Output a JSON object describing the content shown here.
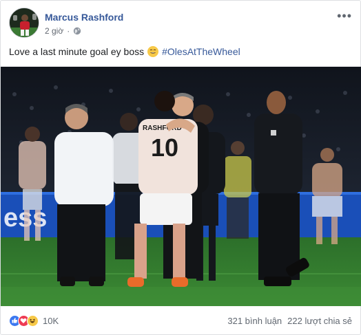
{
  "post": {
    "author": "Marcus Rashford",
    "time": "2 giờ",
    "caption_text": "Love a last minute goal ey boss",
    "hashtag": "#OlesAtTheWheel",
    "photo_jersey_name": "RASHFORD",
    "photo_jersey_number": "10",
    "photo_banner_text": "ess"
  },
  "footer": {
    "reaction_count": "10K",
    "comments": "321 bình luận",
    "shares": "222 lượt chia sẻ"
  },
  "colors": {
    "link": "#365899",
    "pitch": "#2f7a2c",
    "like": "#3b78f0",
    "love": "#ee3b53",
    "haha": "#f7c948"
  },
  "icons": [
    "globe-icon",
    "more-options-icon",
    "grin-emoji-icon",
    "like-reaction-icon",
    "love-reaction-icon",
    "haha-reaction-icon"
  ]
}
